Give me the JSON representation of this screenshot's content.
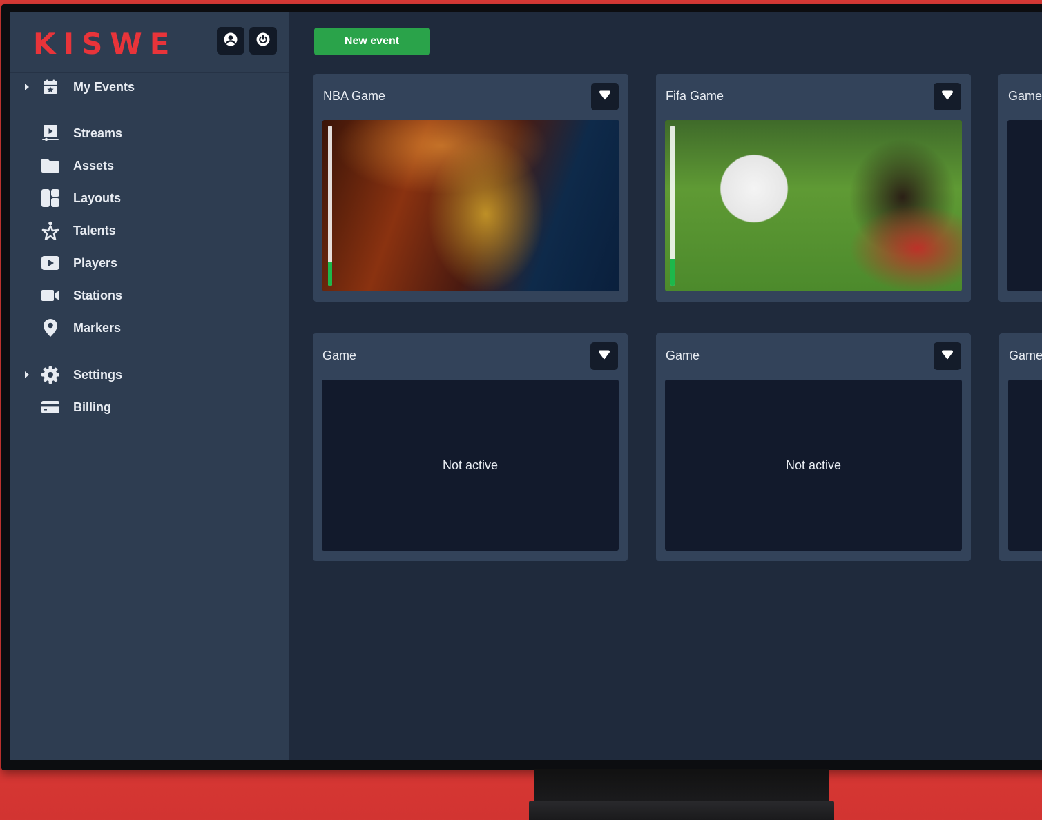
{
  "app": {
    "logo_text": "KISWE",
    "brand_color": "#e8343a"
  },
  "header_buttons": {
    "profile_icon": "user-circle-icon",
    "power_icon": "power-icon"
  },
  "sidebar": {
    "items": [
      {
        "label": "My Events",
        "icon": "calendar-star-icon",
        "expandable": true
      },
      {
        "label": "Streams",
        "icon": "video-stream-icon",
        "expandable": false
      },
      {
        "label": "Assets",
        "icon": "folder-icon",
        "expandable": false
      },
      {
        "label": "Layouts",
        "icon": "layout-icon",
        "expandable": false
      },
      {
        "label": "Talents",
        "icon": "star-person-icon",
        "expandable": false
      },
      {
        "label": "Players",
        "icon": "play-icon",
        "expandable": false
      },
      {
        "label": "Stations",
        "icon": "camera-icon",
        "expandable": false
      },
      {
        "label": "Markers",
        "icon": "map-pin-icon",
        "expandable": false
      },
      {
        "label": "Settings",
        "icon": "gear-icon",
        "expandable": true
      },
      {
        "label": "Billing",
        "icon": "credit-card-icon",
        "expandable": false
      }
    ]
  },
  "main": {
    "new_event_label": "New event",
    "new_event_color": "#2aa34a",
    "events": [
      {
        "title": "NBA Game",
        "state": "live",
        "audio_level": 0.15
      },
      {
        "title": "Fifa Game",
        "state": "live",
        "audio_level": 0.17
      },
      {
        "title": "Game",
        "state": "live",
        "status_text": ""
      },
      {
        "title": "Game",
        "state": "inactive",
        "status_text": "Not active"
      },
      {
        "title": "Game",
        "state": "inactive",
        "status_text": "Not active"
      },
      {
        "title": "Game",
        "state": "inactive",
        "status_text": ""
      }
    ]
  }
}
